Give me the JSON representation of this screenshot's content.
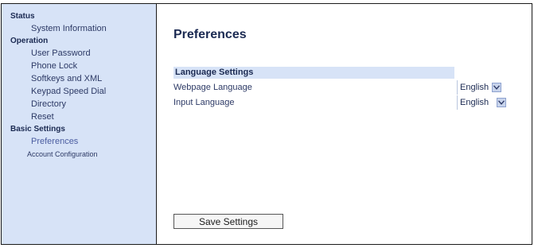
{
  "sidebar": {
    "status": {
      "heading": "Status",
      "items": [
        "System Information"
      ]
    },
    "operation": {
      "heading": "Operation",
      "items": [
        "User Password",
        "Phone Lock",
        "Softkeys and XML",
        "Keypad Speed Dial",
        "Directory",
        "Reset"
      ]
    },
    "basic_settings": {
      "heading": "Basic Settings",
      "items": [
        "Preferences",
        "Account Configuration"
      ]
    }
  },
  "main": {
    "title": "Preferences",
    "section_title": "Language Settings",
    "rows": [
      {
        "label": "Webpage Language",
        "value": "English"
      },
      {
        "label": "Input Language",
        "value": "English"
      }
    ],
    "save_label": "Save Settings"
  },
  "colors": {
    "sidebar_bg": "#d7e3f7",
    "section_bar_bg": "#d7e3f7",
    "text_dark": "#1b2a52",
    "border": "#1a1a1a"
  }
}
